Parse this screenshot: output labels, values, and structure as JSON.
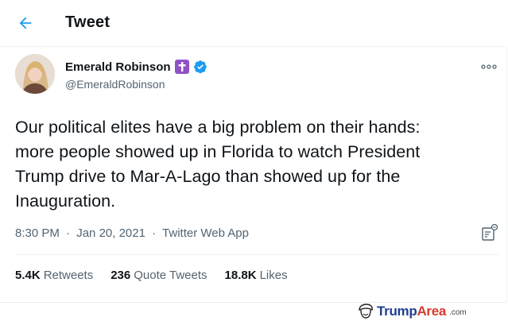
{
  "header": {
    "title": "Tweet",
    "back_icon": "arrow-left-icon"
  },
  "tweet": {
    "author_name": "Emerald Robinson",
    "author_emoji": "latin-cross-emoji",
    "verified_icon": "verified-badge-icon",
    "handle": "@EmeraldRobinson",
    "text_lines": [
      "Our political elites have a big problem on their hands:",
      "more people showed up in Florida to watch President",
      "Trump drive to Mar-A-Lago than showed up for the",
      "Inauguration."
    ],
    "time": "8:30 PM",
    "date": "Jan 20, 2021",
    "source": "Twitter Web App",
    "separator": "·"
  },
  "stats": {
    "retweets_count": "5.4K",
    "retweets_label": "Retweets",
    "quote_count": "236",
    "quote_label": "Quote Tweets",
    "likes_count": "18.8K",
    "likes_label": "Likes"
  },
  "watermark": {
    "brand_part1": "Trump",
    "brand_part2": "Area",
    "suffix": ".com"
  },
  "colors": {
    "accent": "#1d9bf0",
    "text_primary": "#0f1419",
    "text_secondary": "#536471",
    "badge_purple": "#8f52c7",
    "watermark_blue": "#1f3f8f",
    "watermark_red": "#d43a2f"
  }
}
